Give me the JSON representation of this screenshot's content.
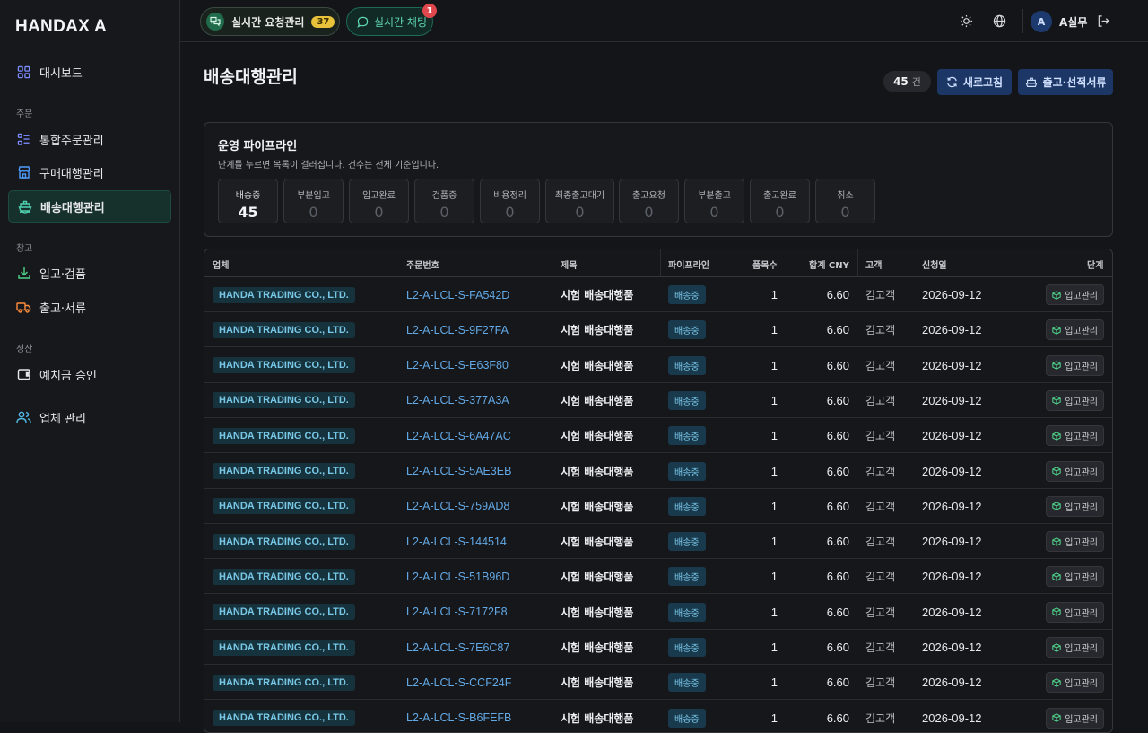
{
  "app": {
    "logo": "HANDAX A"
  },
  "sidebar": {
    "dashboard": "대시보드",
    "section_orders": "주문",
    "integrated_orders": "통합주문관리",
    "purchase_agency": "구매대행관리",
    "shipping_agency": "배송대행관리",
    "section_warehouse": "창고",
    "inbound_inspection": "입고·검품",
    "outbound_docs": "출고·서류",
    "section_settlement": "정산",
    "deposit_approval": "예치금 승인",
    "vendor_management": "업체 관리"
  },
  "topbar": {
    "realtime_requests": "실시간 요청관리",
    "realtime_requests_count": "37",
    "realtime_chat": "실시간 채팅",
    "chat_unread": "1",
    "avatar_initial": "A",
    "user_name": "A실무"
  },
  "page": {
    "title": "배송대행관리",
    "count": "45",
    "count_unit": "건",
    "refresh_label": "새로고침",
    "docs_label": "출고·선적서류"
  },
  "pipeline": {
    "title": "운영 파이프라인",
    "subtitle": "단계를 누르면 목록이 걸러집니다. 건수는 전체 기준입니다.",
    "stages": [
      {
        "label": "배송중",
        "count": "45"
      },
      {
        "label": "부분입고",
        "count": "0"
      },
      {
        "label": "입고완료",
        "count": "0"
      },
      {
        "label": "검품중",
        "count": "0"
      },
      {
        "label": "비용정리",
        "count": "0"
      },
      {
        "label": "최종출고대기",
        "count": "0"
      },
      {
        "label": "출고요청",
        "count": "0"
      },
      {
        "label": "부분출고",
        "count": "0"
      },
      {
        "label": "출고완료",
        "count": "0"
      },
      {
        "label": "취소",
        "count": "0"
      }
    ]
  },
  "table": {
    "headers": {
      "vendor": "업체",
      "order_no": "주문번호",
      "product": "제목",
      "pipeline": "파이프라인",
      "items": "품목수",
      "total": "합계 CNY",
      "customer": "고객",
      "date": "신청일",
      "stage": "단계"
    },
    "rows": [
      {
        "vendor": "HANDA TRADING CO., LTD.",
        "order_no": "L2-A-LCL-S-FA542D",
        "product": "시험 배송대행품",
        "pipeline": "배송중",
        "items": "1",
        "total": "6.60",
        "customer": "김고객",
        "date": "2026-09-12",
        "stage": "입고관리"
      },
      {
        "vendor": "HANDA TRADING CO., LTD.",
        "order_no": "L2-A-LCL-S-9F27FA",
        "product": "시험 배송대행품",
        "pipeline": "배송중",
        "items": "1",
        "total": "6.60",
        "customer": "김고객",
        "date": "2026-09-12",
        "stage": "입고관리"
      },
      {
        "vendor": "HANDA TRADING CO., LTD.",
        "order_no": "L2-A-LCL-S-E63F80",
        "product": "시험 배송대행품",
        "pipeline": "배송중",
        "items": "1",
        "total": "6.60",
        "customer": "김고객",
        "date": "2026-09-12",
        "stage": "입고관리"
      },
      {
        "vendor": "HANDA TRADING CO., LTD.",
        "order_no": "L2-A-LCL-S-377A3A",
        "product": "시험 배송대행품",
        "pipeline": "배송중",
        "items": "1",
        "total": "6.60",
        "customer": "김고객",
        "date": "2026-09-12",
        "stage": "입고관리"
      },
      {
        "vendor": "HANDA TRADING CO., LTD.",
        "order_no": "L2-A-LCL-S-6A47AC",
        "product": "시험 배송대행품",
        "pipeline": "배송중",
        "items": "1",
        "total": "6.60",
        "customer": "김고객",
        "date": "2026-09-12",
        "stage": "입고관리"
      },
      {
        "vendor": "HANDA TRADING CO., LTD.",
        "order_no": "L2-A-LCL-S-5AE3EB",
        "product": "시험 배송대행품",
        "pipeline": "배송중",
        "items": "1",
        "total": "6.60",
        "customer": "김고객",
        "date": "2026-09-12",
        "stage": "입고관리"
      },
      {
        "vendor": "HANDA TRADING CO., LTD.",
        "order_no": "L2-A-LCL-S-759AD8",
        "product": "시험 배송대행품",
        "pipeline": "배송중",
        "items": "1",
        "total": "6.60",
        "customer": "김고객",
        "date": "2026-09-12",
        "stage": "입고관리"
      },
      {
        "vendor": "HANDA TRADING CO., LTD.",
        "order_no": "L2-A-LCL-S-144514",
        "product": "시험 배송대행품",
        "pipeline": "배송중",
        "items": "1",
        "total": "6.60",
        "customer": "김고객",
        "date": "2026-09-12",
        "stage": "입고관리"
      },
      {
        "vendor": "HANDA TRADING CO., LTD.",
        "order_no": "L2-A-LCL-S-51B96D",
        "product": "시험 배송대행품",
        "pipeline": "배송중",
        "items": "1",
        "total": "6.60",
        "customer": "김고객",
        "date": "2026-09-12",
        "stage": "입고관리"
      },
      {
        "vendor": "HANDA TRADING CO., LTD.",
        "order_no": "L2-A-LCL-S-7172F8",
        "product": "시험 배송대행품",
        "pipeline": "배송중",
        "items": "1",
        "total": "6.60",
        "customer": "김고객",
        "date": "2026-09-12",
        "stage": "입고관리"
      },
      {
        "vendor": "HANDA TRADING CO., LTD.",
        "order_no": "L2-A-LCL-S-7E6C87",
        "product": "시험 배송대행품",
        "pipeline": "배송중",
        "items": "1",
        "total": "6.60",
        "customer": "김고객",
        "date": "2026-09-12",
        "stage": "입고관리"
      },
      {
        "vendor": "HANDA TRADING CO., LTD.",
        "order_no": "L2-A-LCL-S-CCF24F",
        "product": "시험 배송대행품",
        "pipeline": "배송중",
        "items": "1",
        "total": "6.60",
        "customer": "김고객",
        "date": "2026-09-12",
        "stage": "입고관리"
      },
      {
        "vendor": "HANDA TRADING CO., LTD.",
        "order_no": "L2-A-LCL-S-B6FEFB",
        "product": "시험 배송대행품",
        "pipeline": "배송중",
        "items": "1",
        "total": "6.60",
        "customer": "김고객",
        "date": "2026-09-12",
        "stage": "입고관리"
      }
    ]
  },
  "colors": {
    "accent_active_nav": "#16302c",
    "primary_button": "#1c3766",
    "vendor_chip_text": "#78c7e6",
    "order_link": "#62a8e5",
    "badge_yellow": "#e7c23a",
    "notif_red": "#e0474c"
  }
}
